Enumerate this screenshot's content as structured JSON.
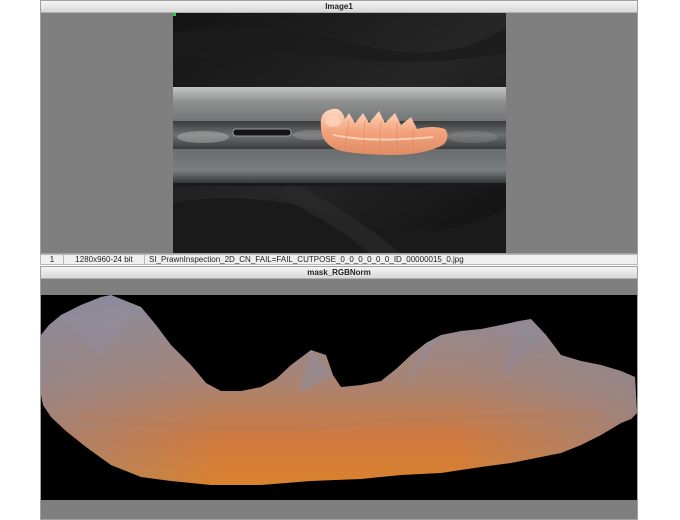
{
  "panels": {
    "image1": {
      "title": "Image1"
    },
    "mask": {
      "title": "mask_RGBNorm"
    }
  },
  "status": {
    "index": "1",
    "size": "1280x960-24 bit",
    "filename": "SI_PrawnInspection_2D_CN_FAIL=FAIL_CUTPOSE_0_0_0_0_0_0_ID_00000015_0.jpg"
  },
  "colors": {
    "panel_bg": "#7f7f7f",
    "title_bg": "#e4e4e4",
    "photo_bg": "#0c0c0c",
    "mask_bg": "#000000",
    "prawn": "#f0a27a",
    "mask_orange": "#d2783c",
    "mask_gray": "#8a8898"
  }
}
